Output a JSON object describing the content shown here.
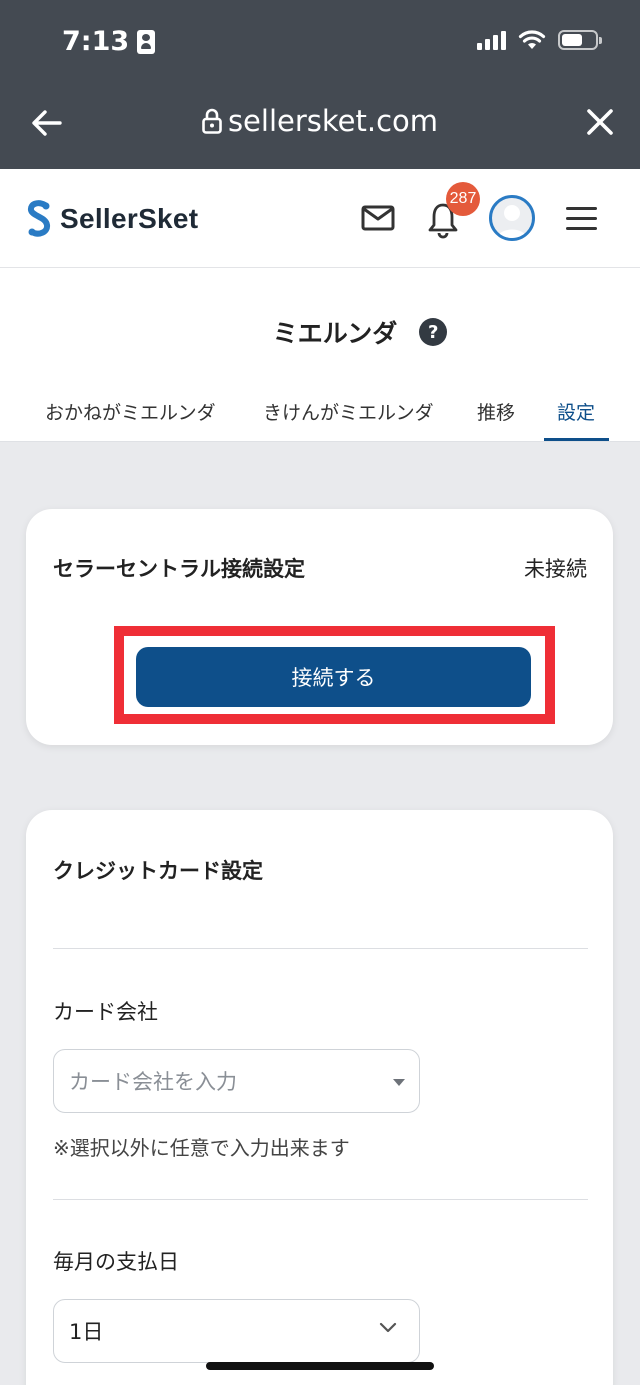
{
  "status_bar": {
    "time": "7:13"
  },
  "browser": {
    "url": "sellersket.com"
  },
  "header": {
    "logo_text": "SellerSket",
    "notification_count": "287",
    "brand_color": "#0e4f8a",
    "badge_color": "#e45a3b"
  },
  "page": {
    "title": "ミエルンダ",
    "help_symbol": "?",
    "tabs": [
      {
        "label": "おかねがミエルンダ",
        "active": false
      },
      {
        "label": "きけんがミエルンダ",
        "active": false
      },
      {
        "label": "推移",
        "active": false
      },
      {
        "label": "設定",
        "active": true
      }
    ]
  },
  "seller_central": {
    "title": "セラーセントラル接続設定",
    "status": "未接続",
    "connect_label": "接続する",
    "highlight_color": "#ef2e36"
  },
  "credit_card": {
    "title": "クレジットカード設定",
    "company_label": "カード会社",
    "company_placeholder": "カード会社を入力",
    "company_note": "※選択以外に任意で入力出来ます",
    "payday_label": "毎月の支払日",
    "payday_value": "1日"
  }
}
